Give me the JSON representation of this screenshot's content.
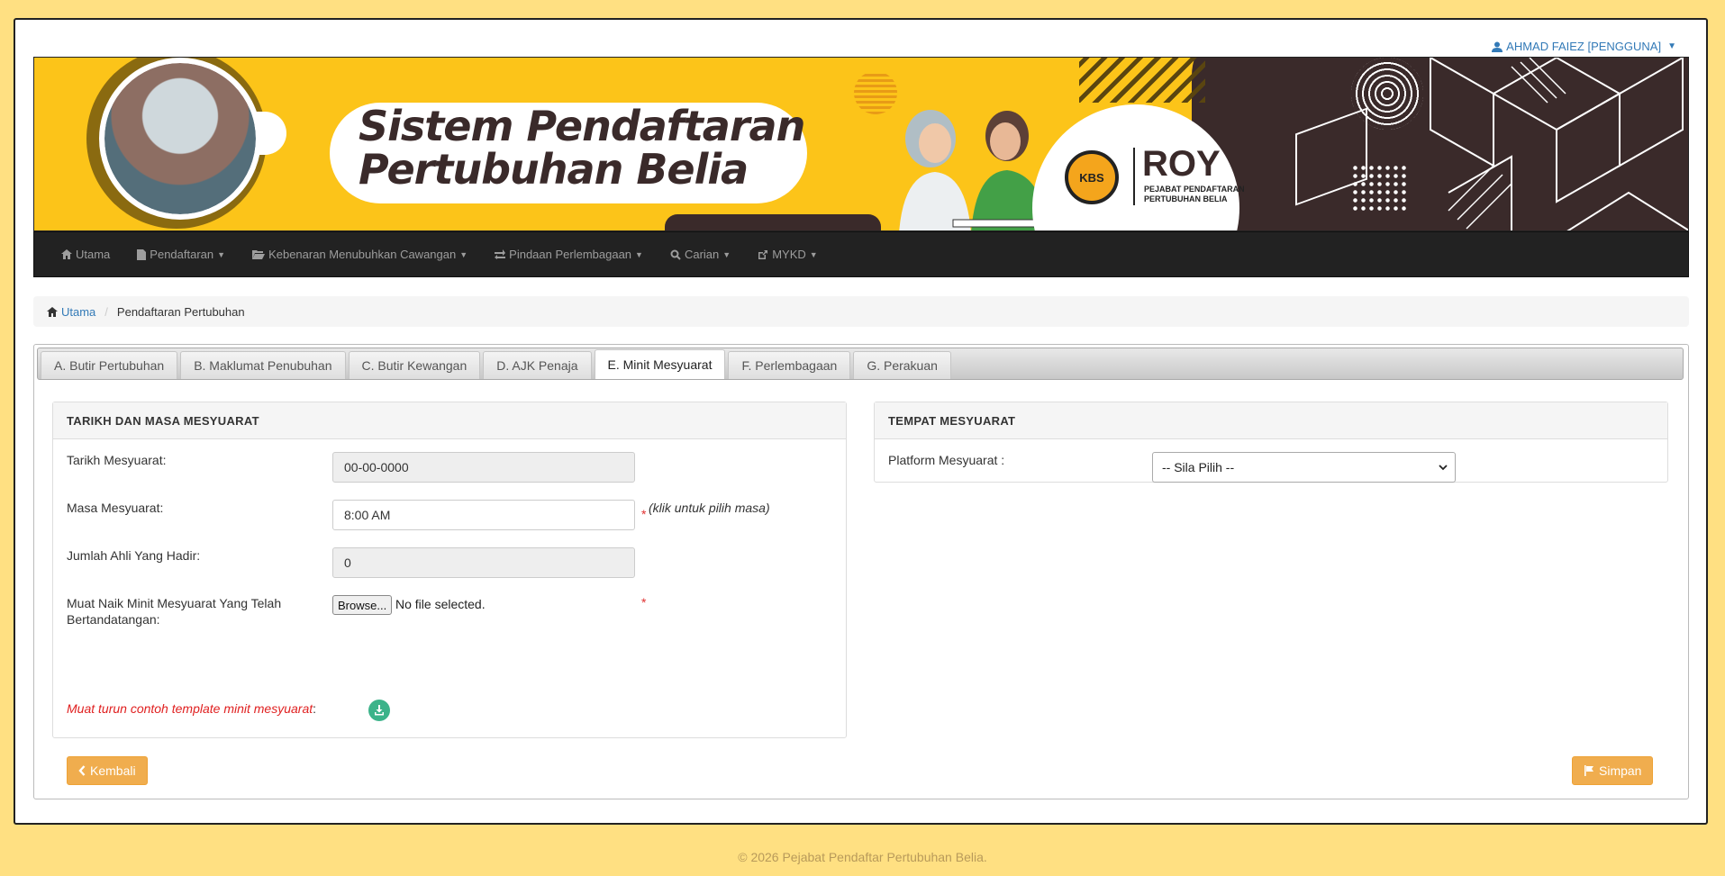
{
  "user": {
    "name": "AHMAD FAIEZ [PENGGUNA]"
  },
  "banner": {
    "title_line1": "Sistem  Pendaftaran",
    "title_line2": "Pertubuhan Belia",
    "logo_kbs": "KBS",
    "logo_roy": "ROY",
    "logo_sub_line1": "PEJABAT PENDAFTARAN",
    "logo_sub_line2": "PERTUBUHAN BELIA"
  },
  "nav": {
    "items": [
      {
        "label": "Utama",
        "icon": "home-icon",
        "dropdown": false
      },
      {
        "label": "Pendaftaran",
        "icon": "file-icon",
        "dropdown": true
      },
      {
        "label": "Kebenaran Menubuhkan Cawangan",
        "icon": "folder-open-icon",
        "dropdown": true
      },
      {
        "label": "Pindaan Perlembagaan",
        "icon": "transfer-icon",
        "dropdown": true
      },
      {
        "label": "Carian",
        "icon": "search-icon",
        "dropdown": true
      },
      {
        "label": "MYKD",
        "icon": "external-link-icon",
        "dropdown": true
      }
    ]
  },
  "breadcrumb": {
    "home": "Utama",
    "current": "Pendaftaran Pertubuhan"
  },
  "tabs": [
    {
      "label": "A. Butir Pertubuhan",
      "active": false
    },
    {
      "label": "B. Maklumat Penubuhan",
      "active": false
    },
    {
      "label": "C. Butir Kewangan",
      "active": false
    },
    {
      "label": "D. AJK Penaja",
      "active": false
    },
    {
      "label": "E. Minit Mesyuarat",
      "active": true
    },
    {
      "label": "F. Perlembagaan",
      "active": false
    },
    {
      "label": "G. Perakuan",
      "active": false
    }
  ],
  "left_box": {
    "heading": "TARIKH DAN MASA MESYUARAT",
    "tarikh_label": "Tarikh Mesyuarat:",
    "tarikh_value": "00-00-0000",
    "masa_label": "Masa Mesyuarat:",
    "masa_value": "8:00 AM",
    "masa_hint": "(klik untuk pilih masa)",
    "jumlah_label": "Jumlah Ahli Yang Hadir:",
    "jumlah_value": "0",
    "muat_label_line1": "Muat Naik Minit Mesyuarat Yang Telah",
    "muat_label_line2": "Bertandatangan:",
    "browse_label": "Browse...",
    "file_status": "No file selected.",
    "download_text": "Muat turun contoh template minit mesyuarat",
    "download_colon": ":",
    "required_mark": "*"
  },
  "right_box": {
    "heading": "TEMPAT MESYUARAT",
    "platform_label": "Platform Mesyuarat :",
    "platform_value": "-- Sila Pilih --"
  },
  "buttons": {
    "back": "Kembali",
    "save": "Simpan"
  },
  "footer": {
    "text": "© 2026 Pejabat Pendaftar Pertubuhan Belia."
  },
  "colors": {
    "page_bg": "#ffe082",
    "banner_yellow": "#fcc419",
    "accent_button": "#f0ad4e",
    "link": "#337ab7",
    "required": "#e03030"
  }
}
